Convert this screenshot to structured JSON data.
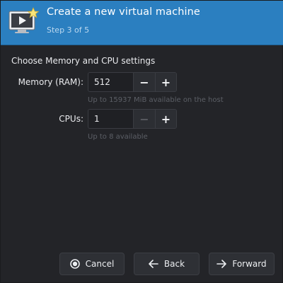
{
  "header": {
    "title": "Create a new virtual machine",
    "subtitle": "Step 3 of 5",
    "icon": "monitor-play-star-icon",
    "accent": "#2b7fc0"
  },
  "section_title": "Choose Memory and CPU settings",
  "memory": {
    "label": "Memory (RAM):",
    "value": "512",
    "decrement": "−",
    "increment": "+",
    "hint": "Up to 15937 MiB available on the host"
  },
  "cpus": {
    "label": "CPUs:",
    "value": "1",
    "decrement": "−",
    "increment": "+",
    "hint": "Up to 8 available",
    "decrement_enabled": false
  },
  "buttons": {
    "cancel": "Cancel",
    "back": "Back",
    "forward": "Forward"
  }
}
